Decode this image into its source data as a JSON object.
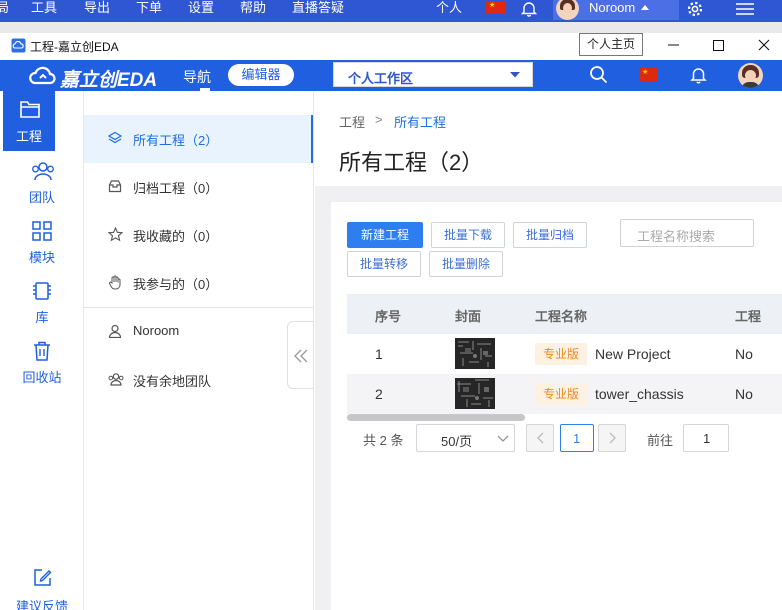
{
  "menubar": {
    "items": [
      "局",
      "工具",
      "导出",
      "下单",
      "设置",
      "帮助",
      "直播答疑"
    ],
    "personal_label": "个人",
    "username": "Noroom"
  },
  "window": {
    "title": "工程-嘉立创EDA",
    "tooltip": "个人主页"
  },
  "header": {
    "logo": "嘉立创EDA",
    "nav_label": "导航",
    "editor_label": "编辑器",
    "workspace": "个人工作区"
  },
  "rail": {
    "items": [
      {
        "label": "工程",
        "icon": "folder-icon",
        "active": true
      },
      {
        "label": "团队",
        "icon": "team-icon"
      },
      {
        "label": "模块",
        "icon": "modules-icon"
      },
      {
        "label": "库",
        "icon": "chip-icon"
      },
      {
        "label": "回收站",
        "icon": "trash-icon"
      }
    ],
    "feedback_label": "建议反馈"
  },
  "categories": {
    "items": [
      {
        "label": "所有工程（2）",
        "icon": "layers-icon",
        "active": true
      },
      {
        "label": "归档工程（0）",
        "icon": "archive-icon"
      },
      {
        "label": "我收藏的（0）",
        "icon": "star-icon"
      },
      {
        "label": "我参与的（0）",
        "icon": "hand-icon"
      }
    ],
    "teams": [
      {
        "label": "Noroom",
        "icon": "user-icon"
      },
      {
        "label": "没有余地团队",
        "icon": "team-icon"
      }
    ]
  },
  "main": {
    "breadcrumb": [
      "工程",
      ">",
      "所有工程"
    ],
    "title": "所有工程（2）",
    "buttons": {
      "new": "新建工程",
      "batch_download": "批量下载",
      "batch_archive": "批量归档",
      "batch_transfer": "批量转移",
      "batch_delete": "批量删除"
    },
    "search_placeholder": "工程名称搜索",
    "table": {
      "headers": [
        "序号",
        "封面",
        "工程名称",
        "工程"
      ],
      "rows": [
        {
          "index": "1",
          "tag": "专业版",
          "name": "New Project",
          "owner": "No"
        },
        {
          "index": "2",
          "tag": "专业版",
          "name": "tower_chassis",
          "owner": "No"
        }
      ]
    },
    "pagination": {
      "total": "共 2 条",
      "page_size": "50/页",
      "current": "1",
      "goto_label": "前往",
      "goto_value": "1"
    }
  },
  "colors": {
    "brand": "#1f5fe0",
    "menubar": "#2f56d3",
    "accent": "#2f7ef0",
    "tag": "#ef8a1e"
  }
}
